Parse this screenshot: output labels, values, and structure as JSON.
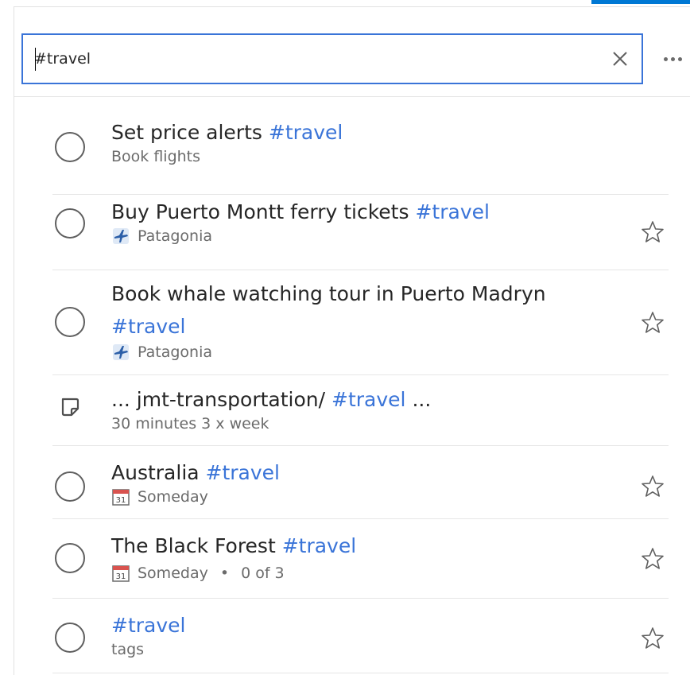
{
  "search": {
    "value": "#travel",
    "placeholder": "",
    "clear_icon": "close-icon",
    "more_icon": "ellipsis-icon"
  },
  "colors": {
    "accent": "#3a74d8",
    "top_accent": "#0078d4",
    "text": "#262626",
    "muted": "#6b6b6b"
  },
  "results": [
    {
      "type": "task",
      "title_text": "Set price alerts ",
      "tag": "#travel",
      "subtitle": "Book flights",
      "subtitle_icon": "",
      "starred": false
    },
    {
      "type": "task",
      "title_text": "Buy Puerto Montt ferry tickets ",
      "tag": "#travel",
      "subtitle": "Patagonia",
      "subtitle_icon": "airplane-icon",
      "starred": false
    },
    {
      "type": "task",
      "title_text": "Book whale watching tour in Puerto Madryn ",
      "tag": "#travel",
      "subtitle": "Patagonia",
      "subtitle_icon": "airplane-icon",
      "starred": false
    },
    {
      "type": "note",
      "title_prefix": "... jmt-transportation/ ",
      "tag": "#travel",
      "title_suffix": " ...",
      "subtitle": "30 minutes 3 x week"
    },
    {
      "type": "task",
      "title_text": "Australia ",
      "tag": "#travel",
      "subtitle": "Someday",
      "subtitle_icon": "calendar-icon",
      "calendar_day": "31",
      "starred": false
    },
    {
      "type": "task",
      "title_text": "The Black Forest ",
      "tag": "#travel",
      "subtitle": "Someday",
      "subtitle_icon": "calendar-icon",
      "calendar_day": "31",
      "dot": "•",
      "extra": "0 of 3",
      "starred": false
    },
    {
      "type": "task",
      "title_text": "",
      "tag": "#travel",
      "subtitle": "tags",
      "subtitle_icon": "",
      "starred": false
    }
  ]
}
